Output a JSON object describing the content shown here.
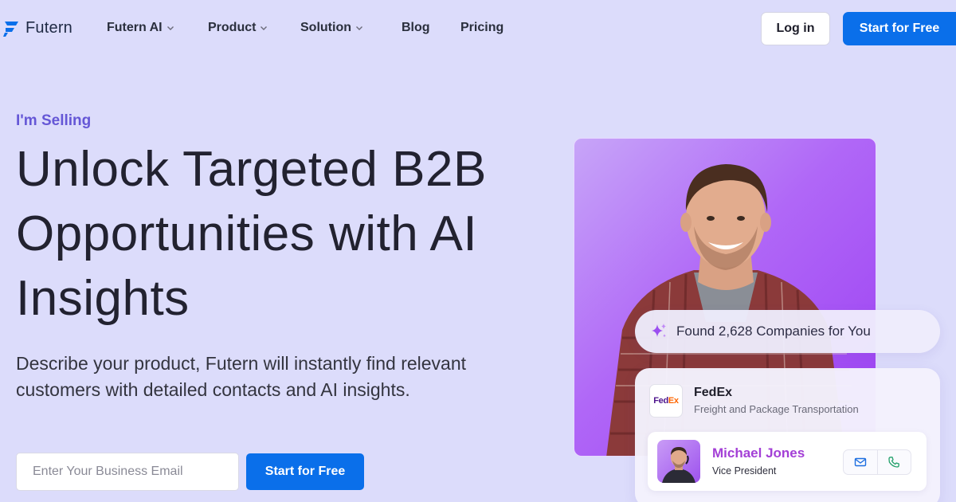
{
  "brand": {
    "name": "Futern",
    "color": "#0a6fea",
    "logo_icon": "futern-logo-icon"
  },
  "nav": {
    "items": [
      {
        "label": "Futern AI",
        "dropdown": true
      },
      {
        "label": "Product",
        "dropdown": true
      },
      {
        "label": "Solution",
        "dropdown": true
      },
      {
        "label": "Blog",
        "dropdown": false
      },
      {
        "label": "Pricing",
        "dropdown": false
      }
    ],
    "login_label": "Log in",
    "start_label": "Start for Free"
  },
  "hero": {
    "eyebrow": "I'm Selling",
    "headline": "Unlock Targeted B2B Opportunities with AI Insights",
    "subhead": "Describe your product, Futern will instantly find relevant customers with detailed contacts and AI insights.",
    "email_placeholder": "Enter Your Business Email",
    "email_value": "",
    "cta_label": "Start for Free"
  },
  "showcase": {
    "found_text": "Found 2,628 Companies for You",
    "company": {
      "logo_text_part1": "Fed",
      "logo_text_part2": "Ex",
      "name": "FedEx",
      "description": "Freight and Package Transportation"
    },
    "contact": {
      "name": "Michael Jones",
      "title": "Vice President",
      "actions": [
        "mail-icon",
        "phone-icon"
      ]
    }
  },
  "colors": {
    "page_bg": "#dcdcfb",
    "accent_purple": "#6557d6",
    "contact_name": "#a33fd6",
    "photo_gradient": [
      "#c7a5f8",
      "#9b3ef2"
    ]
  }
}
